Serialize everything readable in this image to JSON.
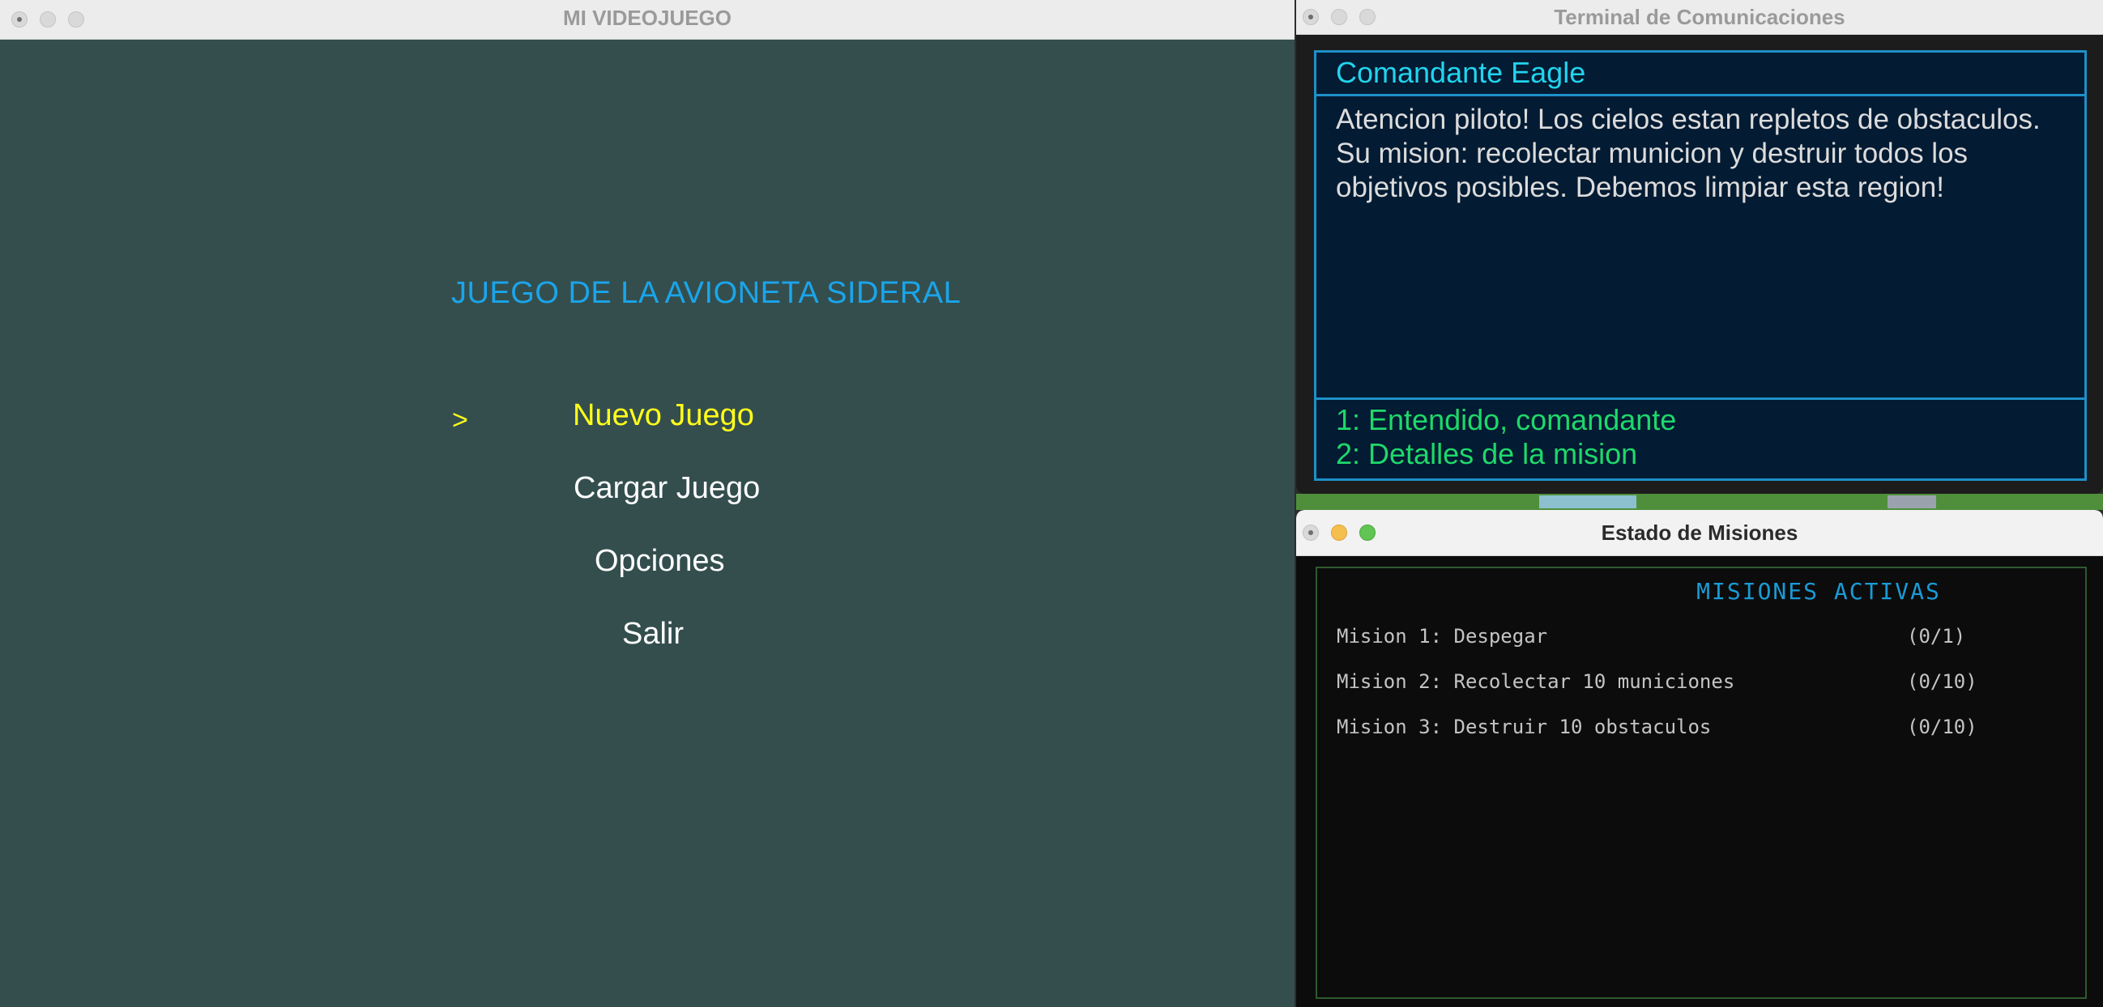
{
  "game_window": {
    "title": "MI VIDEOJUEGO",
    "game_title": "JUEGO DE LA AVIONETA SIDERAL",
    "cursor": ">",
    "menu": [
      {
        "label": "Nuevo Juego",
        "selected": true
      },
      {
        "label": "Cargar Juego",
        "selected": false
      },
      {
        "label": "Opciones",
        "selected": false
      },
      {
        "label": "Salir",
        "selected": false
      }
    ]
  },
  "terminal_window": {
    "title": "Terminal de Comunicaciones",
    "speaker": "Comandante Eagle",
    "message_lines": [
      "Atencion piloto! Los cielos estan repletos de obstaculos.",
      "Su mision: recolectar municion y destruir todos los",
      "objetivos posibles. Debemos limpiar esta region!"
    ],
    "options": [
      "1: Entendido, comandante",
      "2: Detalles de la mision"
    ]
  },
  "missions_window": {
    "title": "Estado de Misiones",
    "header": "MISIONES ACTIVAS",
    "missions": [
      {
        "name": "Mision 1: Despegar",
        "progress": "(0/1)"
      },
      {
        "name": "Mision 2: Recolectar 10 municiones",
        "progress": "(0/10)"
      },
      {
        "name": "Mision 3: Destruir 10 obstaculos",
        "progress": "(0/10)"
      }
    ]
  },
  "colors": {
    "game_bg": "#344e4e",
    "title_blue": "#1aa5ea",
    "selected_yellow": "#ffff1a",
    "terminal_border": "#1e90c9",
    "speaker_cyan": "#22d4ee",
    "option_green": "#1fd86a"
  }
}
